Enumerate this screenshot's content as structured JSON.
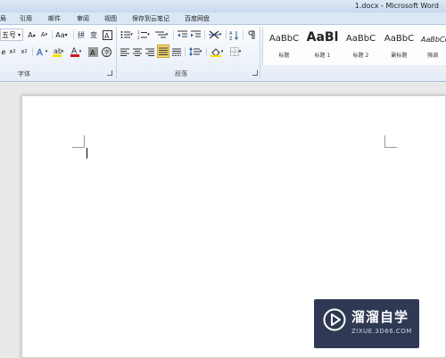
{
  "window": {
    "title": "1.docx - Microsoft Word"
  },
  "tabs": [
    "局",
    "引用",
    "邮件",
    "审阅",
    "视图",
    "保存到云笔记",
    "百度网盘"
  ],
  "ribbon": {
    "font": {
      "font_size_value": "五号",
      "group_label": "字体",
      "change_case_label": "Aa"
    },
    "paragraph": {
      "group_label": "段落"
    },
    "styles": [
      {
        "preview": "AaBbC",
        "name": "标题"
      },
      {
        "preview": "AaBl",
        "name": "标题 1"
      },
      {
        "preview": "AaBbC",
        "name": "标题 2"
      },
      {
        "preview": "AaBbC",
        "name": "副标题"
      },
      {
        "preview": "AaBbCcL",
        "name": "强调"
      }
    ]
  },
  "watermark": {
    "title": "溜溜自学",
    "subtitle": "ZIXUE.3D66.COM"
  },
  "colors": {
    "highlight": "#f5e100",
    "font_color": "#d01818",
    "active_button": "#f7d36a",
    "watermark_bg": "#121e3c"
  }
}
